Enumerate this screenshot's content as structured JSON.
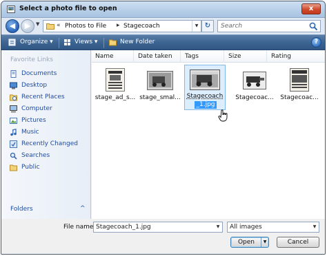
{
  "window": {
    "title": "Select a photo file to open",
    "close_symbol": "x"
  },
  "address": {
    "back_symbol": "◀",
    "forward_symbol": "▶",
    "dropdown_symbol": "▼",
    "prefix_symbol": "«",
    "crumbs": [
      "Photos to File",
      "Stagecoach"
    ],
    "crumb_sep": "▸",
    "refresh_symbol": "↻",
    "search_placeholder": "Search"
  },
  "commandbar": {
    "organize_label": "Organize ▾",
    "views_label": "Views ▾",
    "new_folder_label": "New Folder",
    "help_symbol": "?"
  },
  "navpane": {
    "title": "Favorite Links",
    "items": [
      {
        "label": "Documents",
        "icon": "documents-icon"
      },
      {
        "label": "Desktop",
        "icon": "desktop-icon"
      },
      {
        "label": "Recent Places",
        "icon": "recent-places-icon"
      },
      {
        "label": "Computer",
        "icon": "computer-icon"
      },
      {
        "label": "Pictures",
        "icon": "pictures-icon"
      },
      {
        "label": "Music",
        "icon": "music-icon"
      },
      {
        "label": "Recently Changed",
        "icon": "recently-changed-icon"
      },
      {
        "label": "Searches",
        "icon": "searches-icon"
      },
      {
        "label": "Public",
        "icon": "public-folder-icon"
      }
    ],
    "folders_label": "Folders",
    "folders_chevron": "^"
  },
  "columns": [
    "Name",
    "Date taken",
    "Tags",
    "Size",
    "Rating"
  ],
  "files": [
    {
      "label": "stage_ad_s...",
      "selected": false
    },
    {
      "label": "stage_smal...",
      "selected": false
    },
    {
      "label_line1": "Stagecoach",
      "label_line2": "_1.jpg",
      "selected": true
    },
    {
      "label": "Stagecoac...",
      "selected": false
    },
    {
      "label": "Stagecoac...",
      "selected": false
    }
  ],
  "bottom": {
    "filename_label": "File name:",
    "filename_value": "Stagecoach_1.jpg",
    "filetype_value": "All images",
    "open_label": "Open",
    "cancel_label": "Cancel",
    "dropdown_symbol": "▼"
  },
  "colors": {
    "commandbar": "#3d6592",
    "link": "#1e4a9e",
    "selection": "#dceefd"
  }
}
